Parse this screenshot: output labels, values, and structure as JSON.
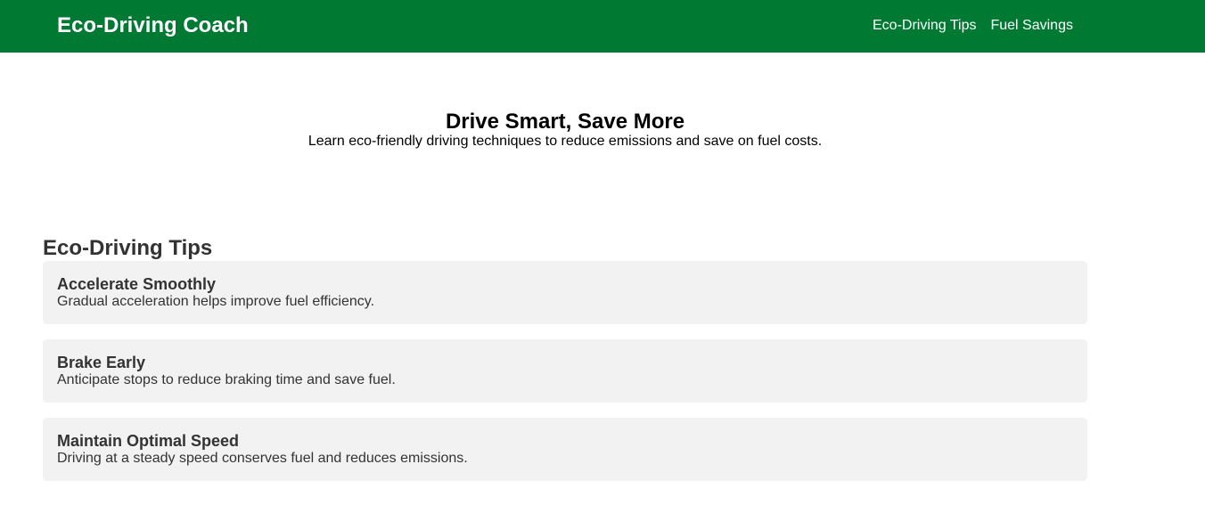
{
  "header": {
    "brand": "Eco-Driving Coach",
    "nav": [
      "Eco-Driving Tips",
      "Fuel Savings"
    ],
    "color": "#007a33"
  },
  "hero": {
    "title": "Drive Smart, Save More",
    "subtitle": "Learn eco-friendly driving techniques to reduce emissions and save on fuel costs."
  },
  "tips_section": {
    "title": "Eco-Driving Tips",
    "items": [
      {
        "title": "Accelerate Smoothly",
        "description": "Gradual acceleration helps improve fuel efficiency."
      },
      {
        "title": "Brake Early",
        "description": "Anticipate stops to reduce braking time and save fuel."
      },
      {
        "title": "Maintain Optimal Speed",
        "description": "Driving at a steady speed conserves fuel and reduces emissions."
      }
    ]
  }
}
